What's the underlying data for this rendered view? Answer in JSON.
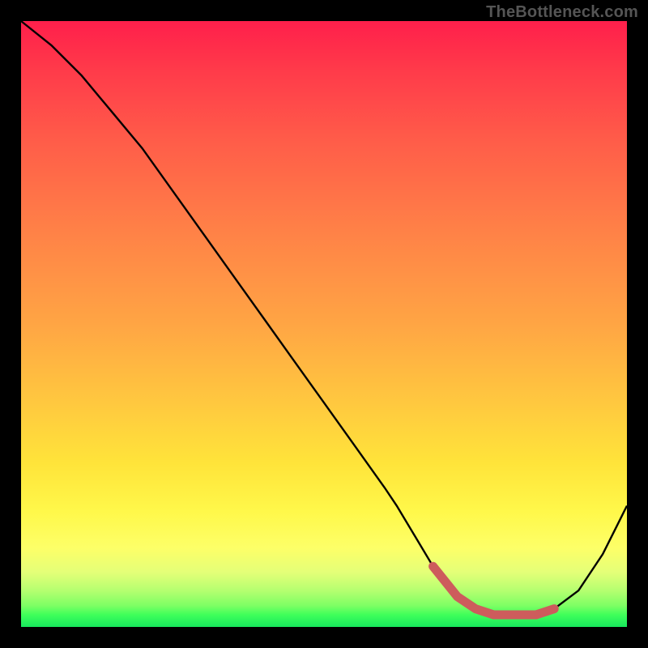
{
  "watermark": "TheBottleneck.com",
  "colors": {
    "frame": "#000000",
    "curve": "#000000",
    "marker": "#cd5c5c",
    "gradient_top": "#ff1f4b",
    "gradient_bottom": "#17e85d"
  },
  "chart_data": {
    "type": "line",
    "title": "",
    "xlabel": "",
    "ylabel": "",
    "xlim": [
      0,
      100
    ],
    "ylim": [
      0,
      100
    ],
    "grid": false,
    "legend": false,
    "x": [
      0,
      5,
      10,
      15,
      20,
      25,
      30,
      35,
      40,
      45,
      50,
      55,
      60,
      62,
      65,
      68,
      72,
      75,
      78,
      80,
      82,
      85,
      88,
      92,
      96,
      100
    ],
    "y": [
      100,
      96,
      91,
      85,
      79,
      72,
      65,
      58,
      51,
      44,
      37,
      30,
      23,
      20,
      15,
      10,
      5,
      3,
      2,
      2,
      2,
      2,
      3,
      6,
      12,
      20
    ],
    "marker_points_x": [
      68,
      72,
      75,
      78,
      80,
      82,
      85,
      88
    ],
    "marker_points_y": [
      10,
      5,
      3,
      2,
      2,
      2,
      2,
      3
    ],
    "annotations": []
  }
}
